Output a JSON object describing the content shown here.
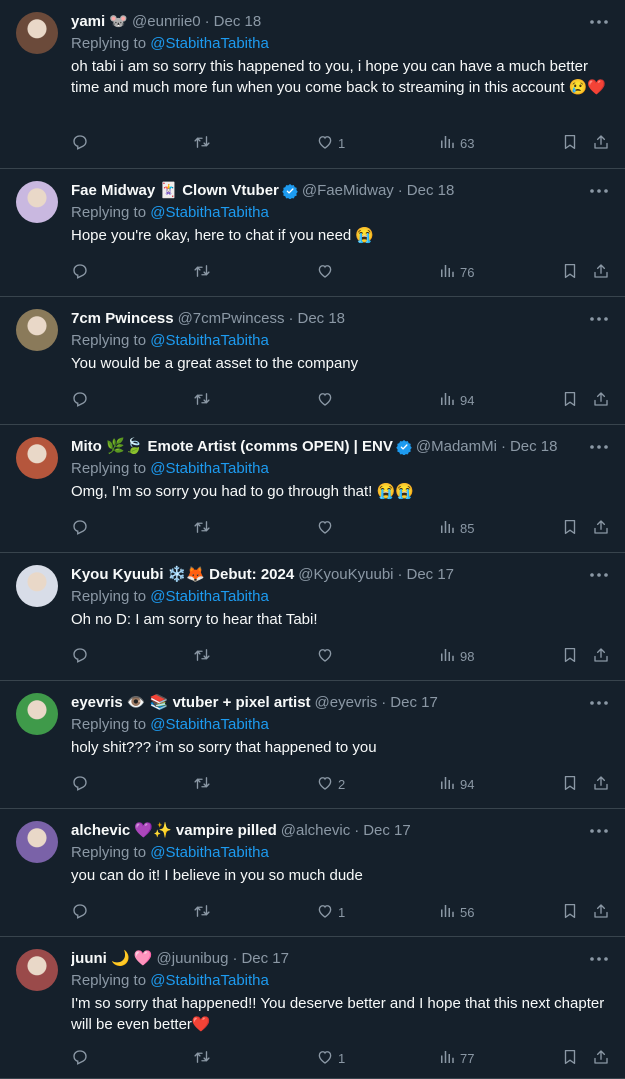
{
  "replying_prefix": "Replying to",
  "replies": [
    {
      "name": "yami 🐭",
      "handle": "@eunriie0",
      "date": "Dec 18",
      "replying_to": "@StabithaTabitha",
      "text": "oh tabi i am so sorry this happened to you, i hope you can have a much better time and much more fun when you come back to streaming in this account 😢❤️",
      "likes": "1",
      "views": "63",
      "verified": false,
      "avatar_color": "#6b4a3a"
    },
    {
      "name": "Fae Midway 🃏 Clown Vtuber",
      "handle": "@FaeMidway",
      "date": "Dec 18",
      "replying_to": "@StabithaTabitha",
      "text": "Hope you're okay, here to chat if you need 😭",
      "likes": "",
      "views": "76",
      "verified": true,
      "avatar_color": "#c9b8e0"
    },
    {
      "name": "7cm Pwincess",
      "handle": "@7cmPwincess",
      "date": "Dec 18",
      "replying_to": "@StabithaTabitha",
      "text": "You would be a great asset to the company",
      "likes": "",
      "views": "94",
      "verified": false,
      "avatar_color": "#8a7a5a"
    },
    {
      "name": "Mito 🌿🍃 Emote Artist (comms OPEN) | ENV",
      "handle": "@MadamMi",
      "date": "Dec 18",
      "replying_to": "@StabithaTabitha",
      "text": "Omg, I'm so sorry you had to go through that! 😭😭",
      "likes": "",
      "views": "85",
      "verified": true,
      "avatar_color": "#b5563c"
    },
    {
      "name": "Kyou Kyuubi ❄️🦊 Debut: 2024",
      "handle": "@KyouKyuubi",
      "date": "Dec 17",
      "replying_to": "@StabithaTabitha",
      "text": "Oh no D: I am sorry to hear that Tabi!",
      "likes": "",
      "views": "98",
      "verified": false,
      "avatar_color": "#d8dde8"
    },
    {
      "name": "eyevris 👁️ 📚 vtuber + pixel artist",
      "handle": "@eyevris",
      "date": "Dec 17",
      "replying_to": "@StabithaTabitha",
      "text": "holy shit??? i'm so sorry that happened to you",
      "likes": "2",
      "views": "94",
      "verified": false,
      "avatar_color": "#3f9a4a"
    },
    {
      "name": "alchevic 💜✨ vampire pilled",
      "handle": "@alchevic",
      "date": "Dec 17",
      "replying_to": "@StabithaTabitha",
      "text": "you can do it! I believe in you so much dude",
      "likes": "1",
      "views": "56",
      "verified": false,
      "avatar_color": "#7a62a8"
    },
    {
      "name": "juuni 🌙 🩷",
      "handle": "@juunibug",
      "date": "Dec 17",
      "replying_to": "@StabithaTabitha",
      "text": "I'm so sorry that happened!! You deserve better and I hope that this next chapter will be even better❤️",
      "likes": "1",
      "views": "77",
      "verified": false,
      "avatar_color": "#9a4a4a"
    }
  ],
  "colors": {
    "background": "#15202b",
    "text": "#f7f9f9",
    "muted": "#8b98a5",
    "accent": "#1d9bf0",
    "divider": "#38444d"
  },
  "icons": [
    "more-icon",
    "reply-icon",
    "retweet-icon",
    "like-icon",
    "views-icon",
    "bookmark-icon",
    "share-icon",
    "verified-icon"
  ]
}
